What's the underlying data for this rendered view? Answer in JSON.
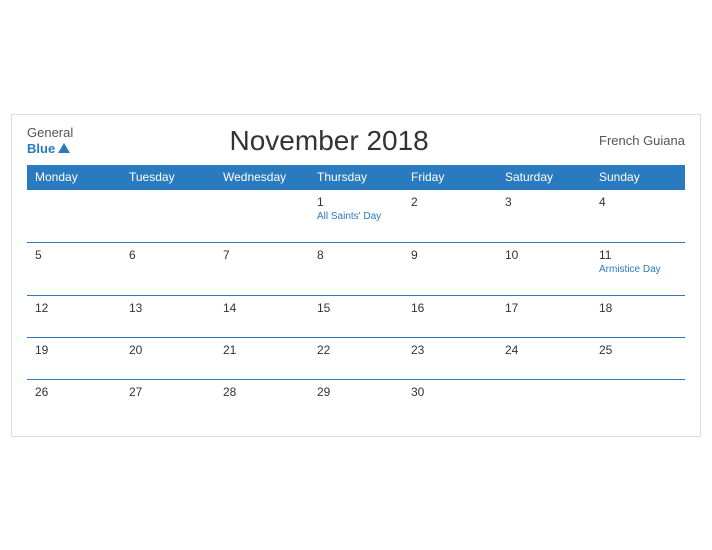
{
  "header": {
    "logo": {
      "general": "General",
      "blue": "Blue",
      "triangle": "▲"
    },
    "title": "November 2018",
    "region": "French Guiana"
  },
  "weekdays": [
    "Monday",
    "Tuesday",
    "Wednesday",
    "Thursday",
    "Friday",
    "Saturday",
    "Sunday"
  ],
  "weeks": [
    [
      {
        "day": "",
        "holiday": "",
        "empty": true
      },
      {
        "day": "",
        "holiday": "",
        "empty": true
      },
      {
        "day": "",
        "holiday": "",
        "empty": true
      },
      {
        "day": "1",
        "holiday": "All Saints' Day"
      },
      {
        "day": "2",
        "holiday": ""
      },
      {
        "day": "3",
        "holiday": ""
      },
      {
        "day": "4",
        "holiday": ""
      }
    ],
    [
      {
        "day": "5",
        "holiday": ""
      },
      {
        "day": "6",
        "holiday": ""
      },
      {
        "day": "7",
        "holiday": ""
      },
      {
        "day": "8",
        "holiday": ""
      },
      {
        "day": "9",
        "holiday": ""
      },
      {
        "day": "10",
        "holiday": ""
      },
      {
        "day": "11",
        "holiday": "Armistice Day"
      }
    ],
    [
      {
        "day": "12",
        "holiday": ""
      },
      {
        "day": "13",
        "holiday": ""
      },
      {
        "day": "14",
        "holiday": ""
      },
      {
        "day": "15",
        "holiday": ""
      },
      {
        "day": "16",
        "holiday": ""
      },
      {
        "day": "17",
        "holiday": ""
      },
      {
        "day": "18",
        "holiday": ""
      }
    ],
    [
      {
        "day": "19",
        "holiday": ""
      },
      {
        "day": "20",
        "holiday": ""
      },
      {
        "day": "21",
        "holiday": ""
      },
      {
        "day": "22",
        "holiday": ""
      },
      {
        "day": "23",
        "holiday": ""
      },
      {
        "day": "24",
        "holiday": ""
      },
      {
        "day": "25",
        "holiday": ""
      }
    ],
    [
      {
        "day": "26",
        "holiday": ""
      },
      {
        "day": "27",
        "holiday": ""
      },
      {
        "day": "28",
        "holiday": ""
      },
      {
        "day": "29",
        "holiday": ""
      },
      {
        "day": "30",
        "holiday": ""
      },
      {
        "day": "",
        "holiday": "",
        "empty": true
      },
      {
        "day": "",
        "holiday": "",
        "empty": true
      }
    ]
  ]
}
